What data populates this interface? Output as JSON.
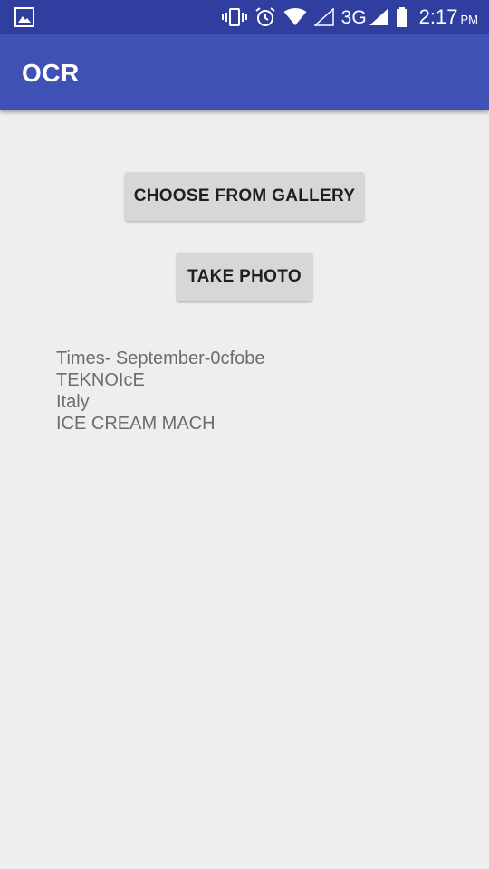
{
  "status_bar": {
    "icons": [
      "image-icon",
      "vibrate-icon",
      "alarm-icon",
      "wifi-icon",
      "signal-empty-icon",
      "signal-full-icon",
      "battery-icon"
    ],
    "network": "3G",
    "time": "2:17",
    "ampm": "PM"
  },
  "app_bar": {
    "title": "OCR",
    "color": "#3f51b5",
    "status_color": "#303f9f"
  },
  "buttons": {
    "gallery_label": "CHOOSE FROM GALLERY",
    "photo_label": "TAKE PHOTO"
  },
  "result": {
    "lines": [
      "Times- September-0cfobe",
      "TEKNOIcE",
      "Italy",
      "ICE CREAM MACH"
    ]
  }
}
